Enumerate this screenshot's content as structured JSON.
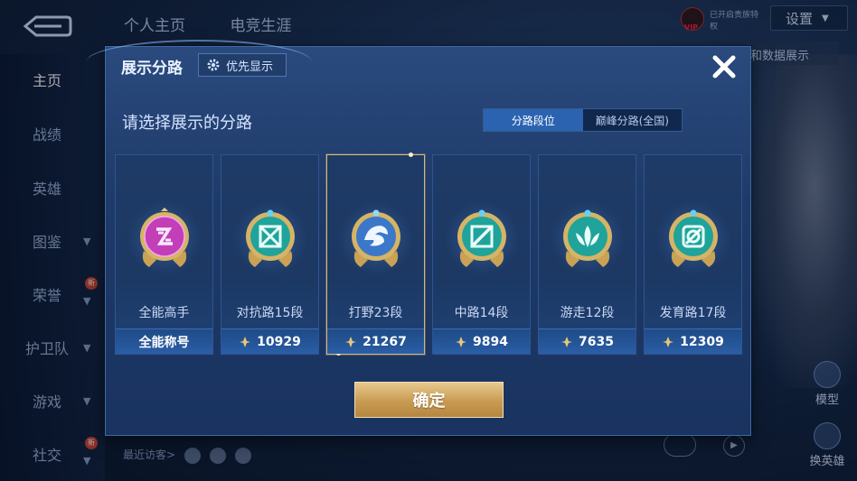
{
  "topbar": {
    "tabs": [
      "个人主页",
      "电竞生涯"
    ],
    "settings_label": "设置",
    "vip_text": "已开启贵族特权",
    "vip_tag": "VIP"
  },
  "sidebar": {
    "items": [
      {
        "label": "主页",
        "active": true,
        "chevron": false,
        "badge": ""
      },
      {
        "label": "战绩",
        "active": false,
        "chevron": false,
        "badge": ""
      },
      {
        "label": "英雄",
        "active": false,
        "chevron": false,
        "badge": ""
      },
      {
        "label": "图鉴",
        "active": false,
        "chevron": true,
        "badge": ""
      },
      {
        "label": "荣誉",
        "active": false,
        "chevron": true,
        "badge": "新"
      },
      {
        "label": "护卫队",
        "active": false,
        "chevron": true,
        "badge": ""
      },
      {
        "label": "游戏",
        "active": false,
        "chevron": true,
        "badge": ""
      },
      {
        "label": "社交",
        "active": false,
        "chevron": true,
        "badge": "新"
      }
    ]
  },
  "background": {
    "hint_right": "和数据展示",
    "model_label": "模型",
    "switch_hero_label": "换英雄",
    "recent_visitors": "最近访客>"
  },
  "modal": {
    "title": "展示分路",
    "priority_label": "优先显示",
    "subtitle": "请选择展示的分路",
    "segments": [
      {
        "label": "分路段位",
        "active": true
      },
      {
        "label": "巅峰分路(全国)",
        "active": false
      }
    ],
    "confirm_label": "确定",
    "cards": [
      {
        "name": "全能高手",
        "score": "全能称号",
        "show_power_icon": false,
        "selected": false,
        "emblem": "allround-emblem-icon",
        "color": "#c23fb8"
      },
      {
        "name": "对抗路15段",
        "score": "10929",
        "show_power_icon": true,
        "selected": false,
        "emblem": "clash-lane-emblem-icon",
        "color": "#1fa39a"
      },
      {
        "name": "打野23段",
        "score": "21267",
        "show_power_icon": true,
        "selected": true,
        "emblem": "jungle-emblem-icon",
        "color": "#3b78c9"
      },
      {
        "name": "中路14段",
        "score": "9894",
        "show_power_icon": true,
        "selected": false,
        "emblem": "mid-lane-emblem-icon",
        "color": "#1fa39a"
      },
      {
        "name": "游走12段",
        "score": "7635",
        "show_power_icon": true,
        "selected": false,
        "emblem": "roam-emblem-icon",
        "color": "#1fa39a"
      },
      {
        "name": "发育路17段",
        "score": "12309",
        "show_power_icon": true,
        "selected": false,
        "emblem": "farm-lane-emblem-icon",
        "color": "#1fa39a"
      }
    ]
  },
  "colors": {
    "accent_blue": "#2b63b0",
    "gold": "#c89b52",
    "selected_border": "#d7b777"
  }
}
